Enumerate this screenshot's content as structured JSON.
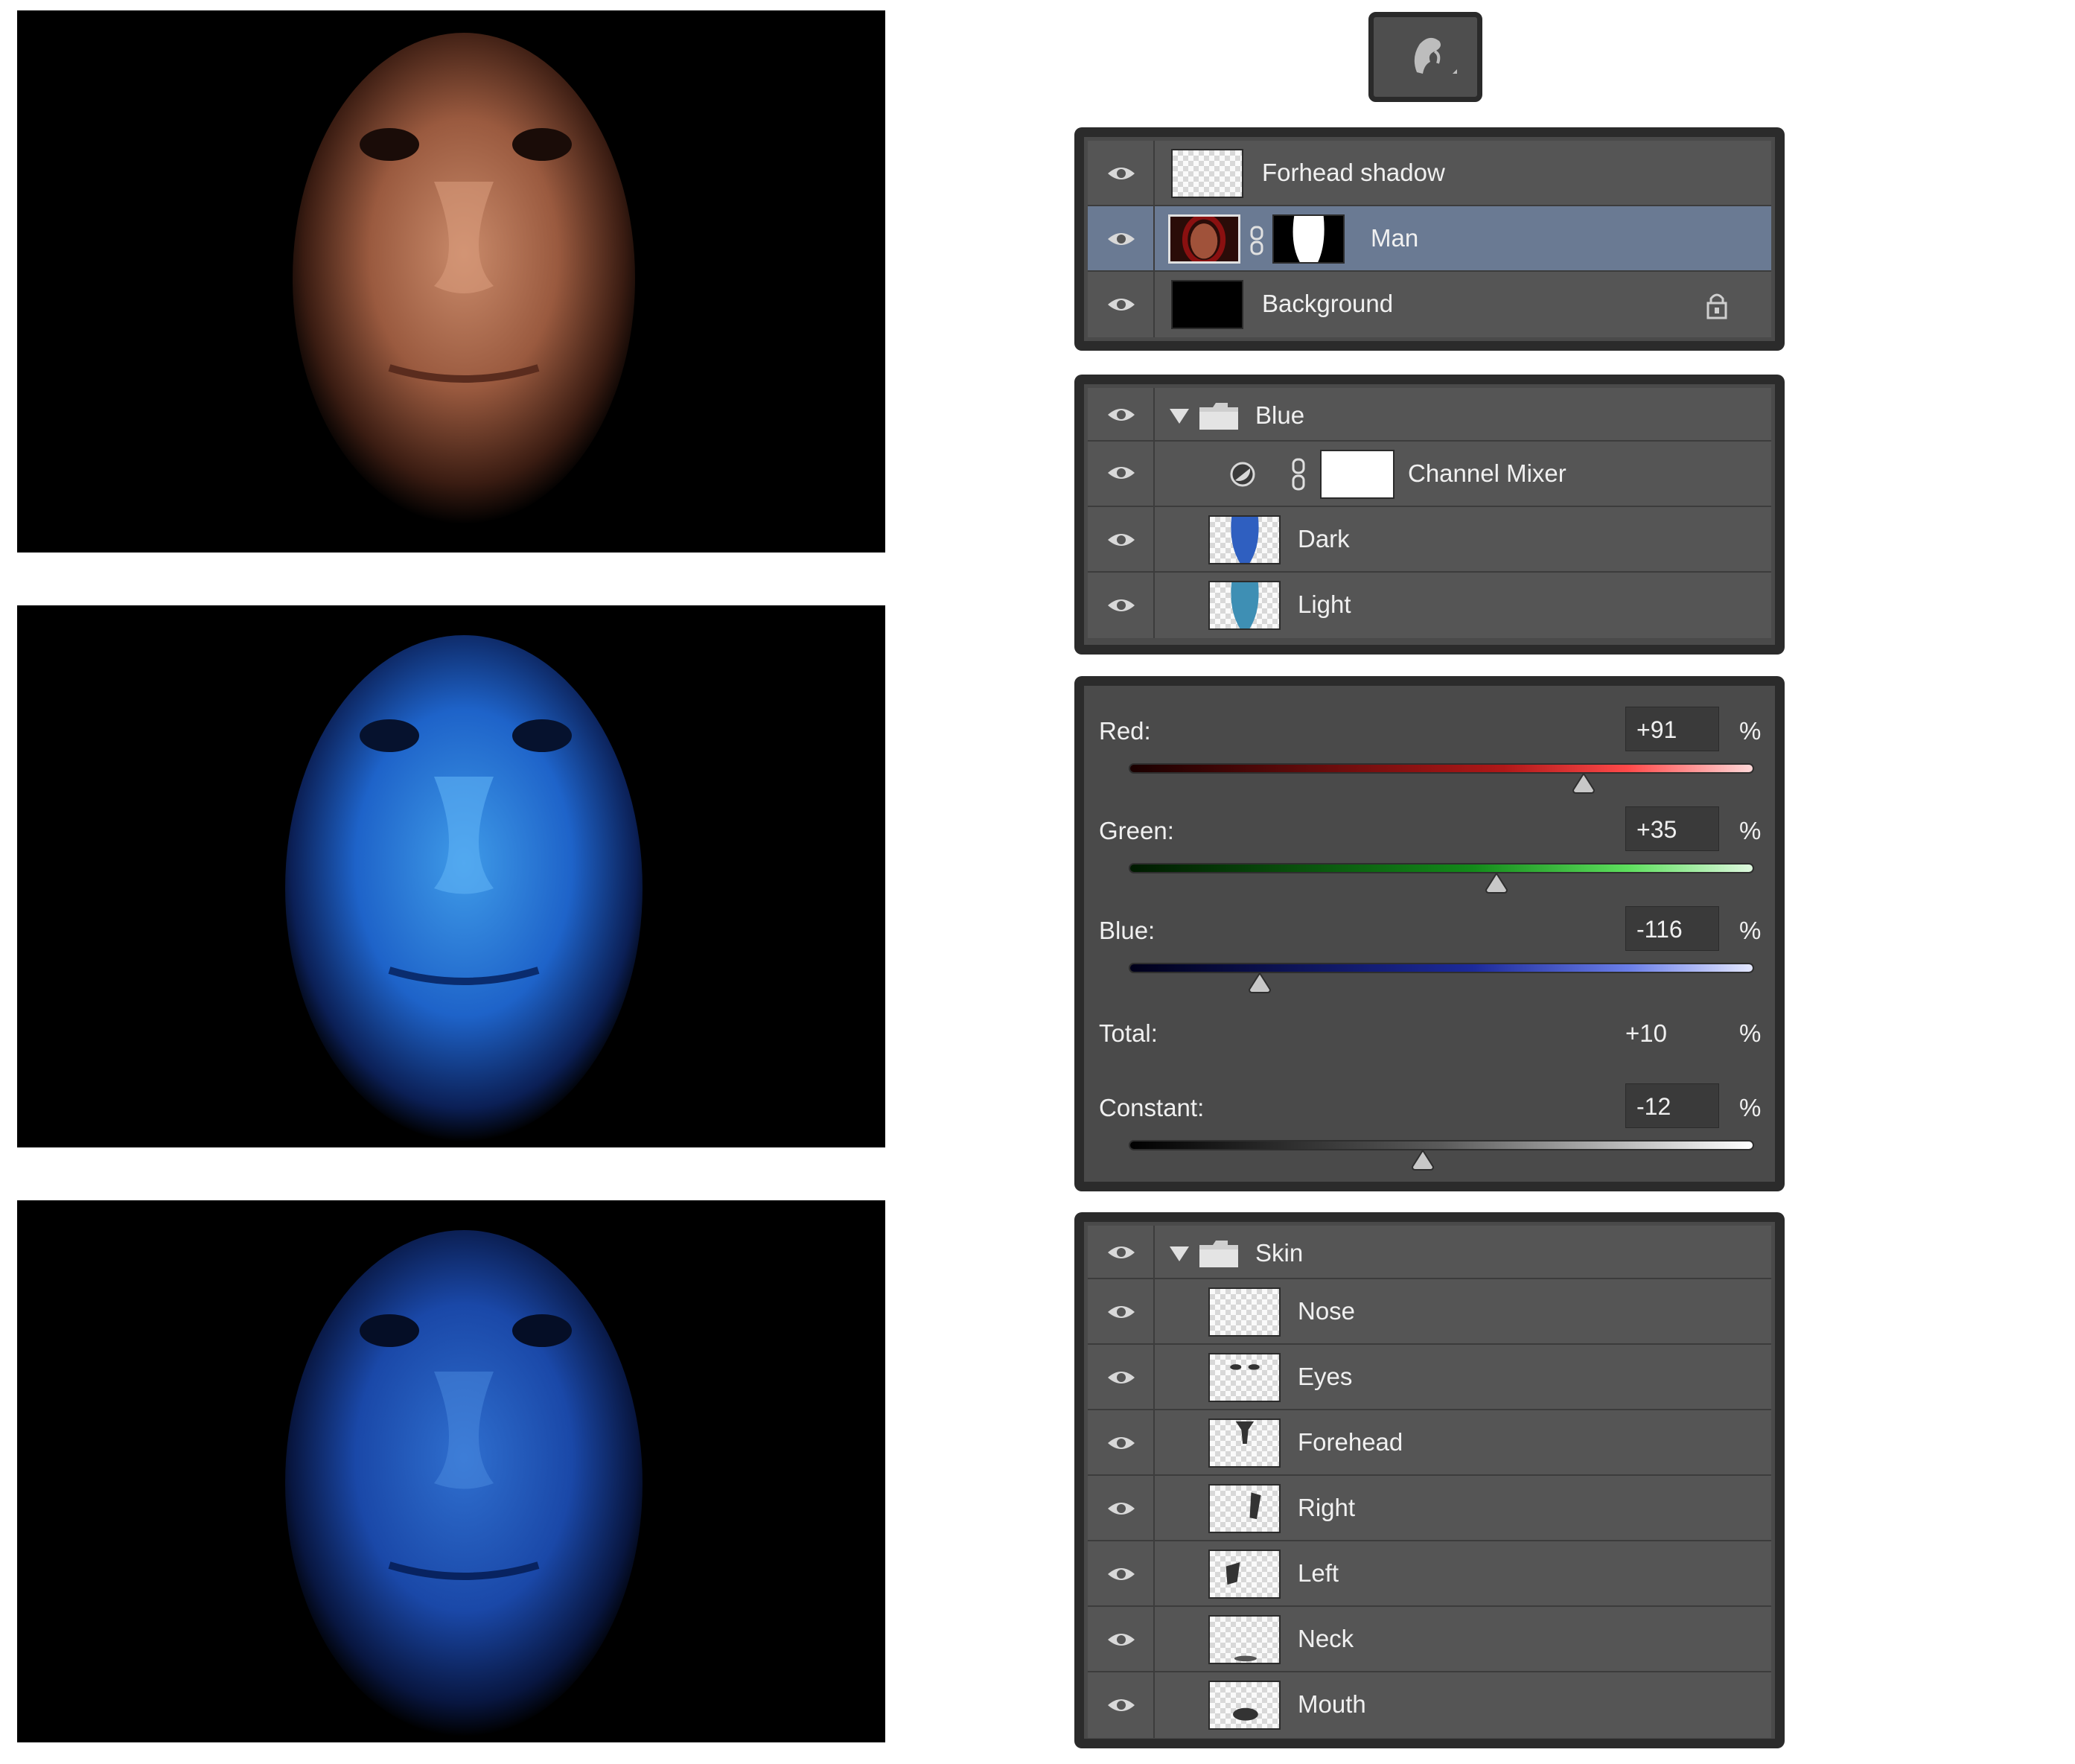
{
  "photos": [
    {
      "name": "Original portrait"
    },
    {
      "name": "Blue channel mixer result"
    },
    {
      "name": "Final blue skin result"
    }
  ],
  "tool_icon": "brush-tool-icon",
  "layers_panel": {
    "rows": [
      {
        "label": "Forhead shadow",
        "thumb": "transparent",
        "selected": false
      },
      {
        "label": "Man",
        "thumb": "photo",
        "selected": true
      },
      {
        "label": "Background",
        "thumb": "black",
        "selected": false,
        "locked": true
      }
    ]
  },
  "blue_group": {
    "group_label": "Blue",
    "rows": [
      {
        "label": "Channel Mixer"
      },
      {
        "label": "Dark"
      },
      {
        "label": "Light"
      }
    ]
  },
  "channel_mixer": {
    "red_label": "Red:",
    "red_value": "+91",
    "green_label": "Green:",
    "green_value": "+35",
    "blue_label": "Blue:",
    "blue_value": "-116",
    "total_label": "Total:",
    "total_value": "+10",
    "constant_label": "Constant:",
    "constant_value": "-12",
    "percent": "%",
    "red_level": 91,
    "green_level": 35,
    "blue_level": -116,
    "constant_level": -12,
    "range": [
      -200,
      200
    ]
  },
  "skin_group": {
    "group_label": "Skin",
    "rows": [
      {
        "label": "Nose"
      },
      {
        "label": "Eyes"
      },
      {
        "label": "Forehead"
      },
      {
        "label": "Right"
      },
      {
        "label": "Left"
      },
      {
        "label": "Neck"
      },
      {
        "label": "Mouth"
      }
    ]
  },
  "colors": {
    "panel_bg": "#555555",
    "panel_border": "#2b2b2b",
    "selected_row": "#6a7a93"
  }
}
